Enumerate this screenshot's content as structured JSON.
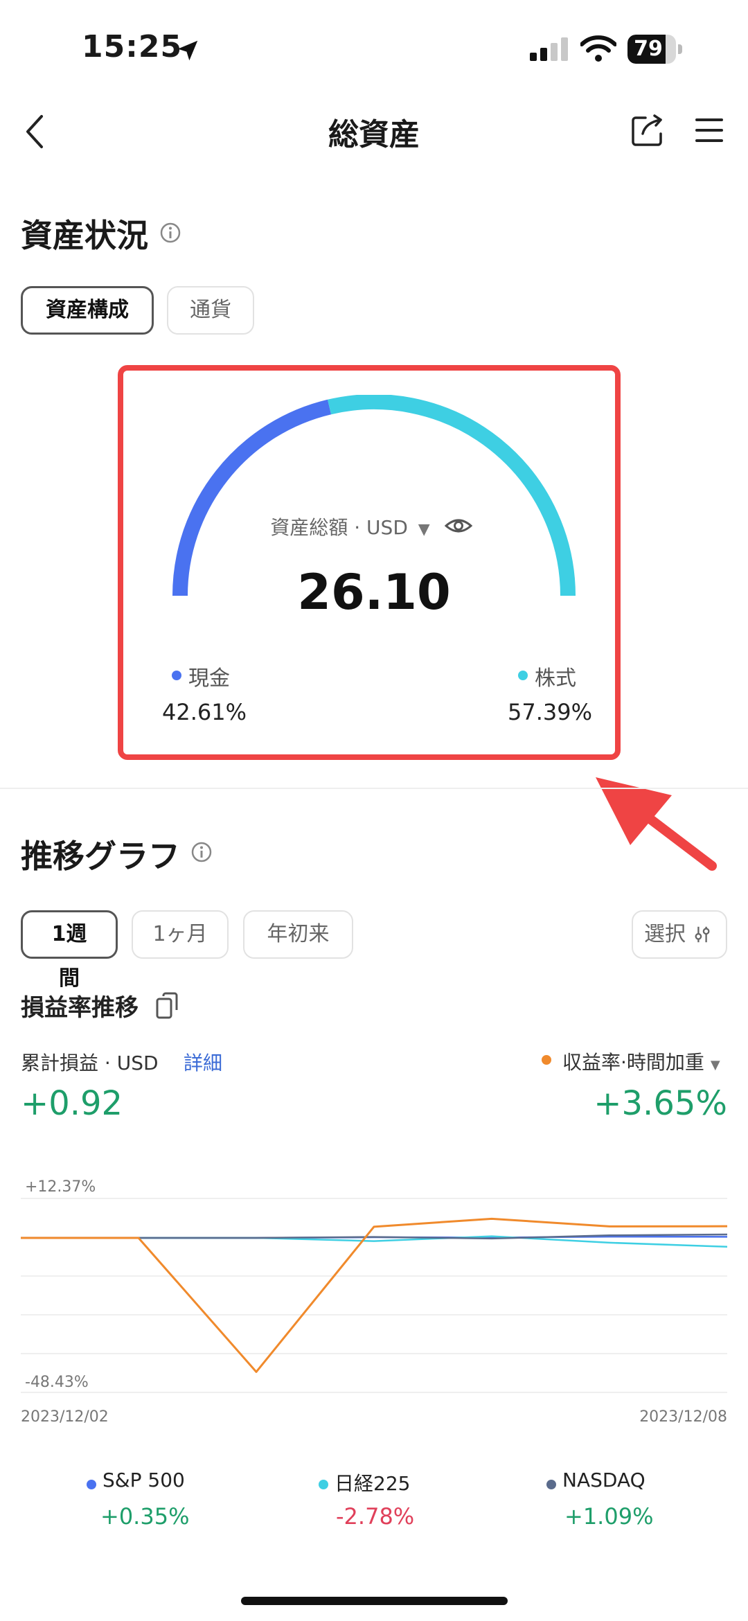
{
  "status_bar": {
    "time": "15:25",
    "battery": "79",
    "battery_level": 0.79
  },
  "nav": {
    "title": "総資産"
  },
  "asset_section": {
    "title": "資産状況",
    "tabs": [
      {
        "label": "資産構成",
        "active": true
      },
      {
        "label": "通貨",
        "active": false
      }
    ],
    "total_label": "資産総額 · USD",
    "total_value": "26.10",
    "composition": [
      {
        "label": "現金",
        "percent": "42.61%",
        "value": 42.61,
        "color": "#4a72f0"
      },
      {
        "label": "株式",
        "percent": "57.39%",
        "value": 57.39,
        "color": "#3ecfe3"
      }
    ],
    "highlight_color": "#ef4444"
  },
  "trend_section": {
    "title": "推移グラフ",
    "period_tabs": [
      {
        "label": "1週間",
        "active": true
      },
      {
        "label": "1ヶ月",
        "active": false
      },
      {
        "label": "年初来",
        "active": false
      }
    ],
    "select_label": "選択",
    "pl_title": "損益率推移",
    "cumulative_label": "累計損益 · USD",
    "detail_link": "詳細",
    "cumulative_value": "+0.92",
    "return_label": "収益率·時間加重",
    "return_value": "+3.65%"
  },
  "chart_data": {
    "type": "line",
    "x": [
      "2023/12/02",
      "2023/12/03",
      "2023/12/04",
      "2023/12/05",
      "2023/12/06",
      "2023/12/07",
      "2023/12/08"
    ],
    "x_tick_labels": [
      "2023/12/02",
      "2023/12/08"
    ],
    "y_tick_labels": [
      "+12.37%",
      "-48.43%"
    ],
    "ylim": [
      -48.43,
      12.37
    ],
    "grid": true,
    "series": [
      {
        "name": "",
        "color": "#f08a2c",
        "values": [
          0,
          0,
          -42.0,
          3.5,
          6.0,
          3.6,
          3.65
        ]
      },
      {
        "name": "S&P 500",
        "color": "#4a72f0",
        "values": [
          0,
          0,
          0,
          0.2,
          0.1,
          0.4,
          0.35
        ]
      },
      {
        "name": "日経225",
        "color": "#3ecfe3",
        "values": [
          0,
          0,
          0,
          -1.0,
          0.5,
          -1.5,
          -2.78
        ]
      },
      {
        "name": "NASDAQ",
        "color": "#5a6b8c",
        "values": [
          0,
          0,
          0,
          0.3,
          -0.2,
          0.8,
          1.09
        ]
      }
    ]
  },
  "benchmarks": [
    {
      "name": "S&P 500",
      "value": "+0.35%",
      "color": "#4a72f0",
      "trend": "up"
    },
    {
      "name": "日経225",
      "value": "-2.78%",
      "color": "#3ecfe3",
      "trend": "down"
    },
    {
      "name": "NASDAQ",
      "value": "+1.09%",
      "color": "#5a6b8c",
      "trend": "up"
    }
  ]
}
